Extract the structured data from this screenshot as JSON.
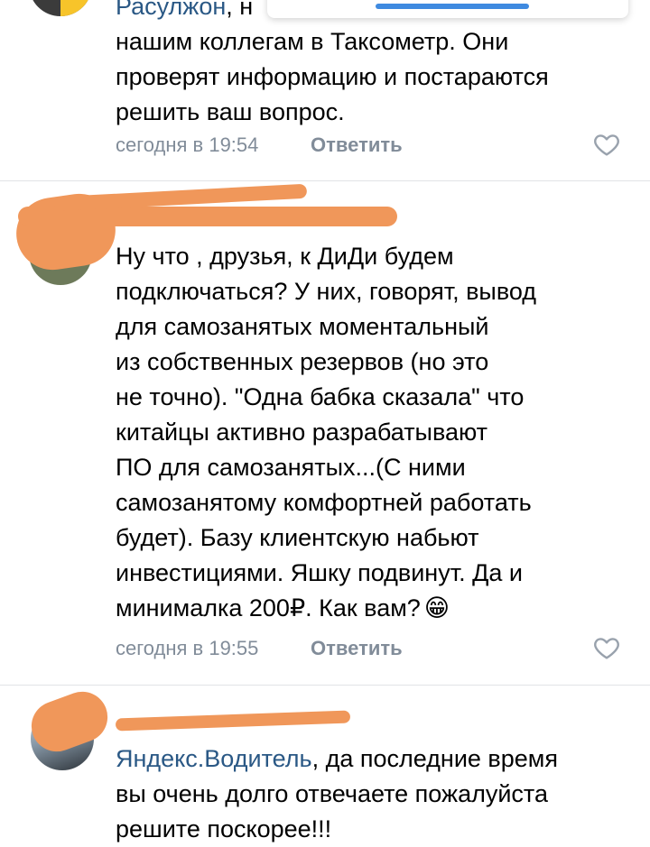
{
  "comments": [
    {
      "mention": "Расулжон",
      "mention_tail": ", н",
      "lines": [
        "нашим коллегам в Таксометр. Они",
        "проверят информацию и постараются",
        "решить ваш вопрос."
      ],
      "time": "сегодня в 19:54",
      "reply_label": "Ответить"
    },
    {
      "lines": [
        "Ну что , друзья, к ДиДи будем",
        "подключаться? У них, говорят, вывод",
        "для самозанятых моментальный",
        "из собственных резервов (но это",
        "не точно). \"Одна бабка сказала\" что",
        "китайцы активно разрабатывают",
        "ПО для самозанятых...(С ними",
        "самозанятому комфортней работать",
        "будет). Базу клиентскую набьют",
        "инвестициями. Яшку подвинут. Да и",
        "минималка 200₽. Как вам?"
      ],
      "emoji": "😁",
      "time": "сегодня в 19:55",
      "reply_label": "Ответить"
    },
    {
      "mention": "Яндекс.Водитель",
      "first_line_tail": ", да последние время",
      "lines": [
        "вы очень долго отвечаете пожалуйста",
        "решите поскорее!!!"
      ]
    }
  ],
  "icons": {
    "like": "heart-outline-icon",
    "avatar_top": "avatar",
    "avatar_bottom": "avatar"
  },
  "colors": {
    "link": "#2a5885",
    "meta": "#818c99",
    "redaction": "#f0975a",
    "divider": "#e1e3e6"
  }
}
